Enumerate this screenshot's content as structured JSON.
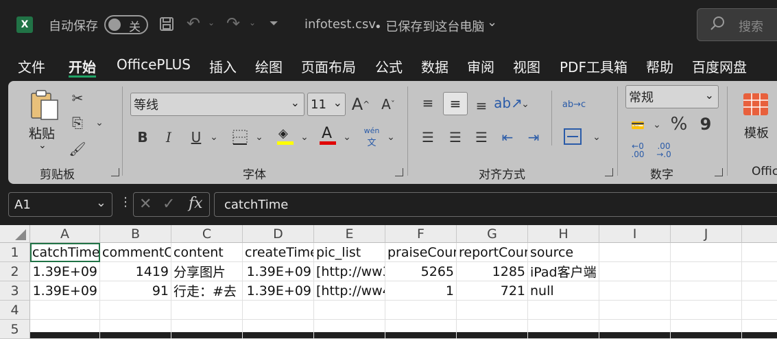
{
  "titlebar": {
    "autosave_label": "自动保存",
    "autosave_state": "关",
    "filename": "infotest.csv",
    "save_status": "• 已保存到这台电脑",
    "search_placeholder": "搜索"
  },
  "tabs": [
    "文件",
    "开始",
    "OfficePLUS",
    "插入",
    "绘图",
    "页面布局",
    "公式",
    "数据",
    "审阅",
    "视图",
    "PDF工具箱",
    "帮助",
    "百度网盘"
  ],
  "ribbon": {
    "clipboard": {
      "paste_label": "粘贴",
      "group_label": "剪贴板"
    },
    "font": {
      "font_name": "等线",
      "font_size": "11",
      "group_label": "字体",
      "bold": "B",
      "italic": "I",
      "underline": "U",
      "grow": "A",
      "shrink": "A",
      "font_color": "A",
      "phonetic_top": "wén",
      "phonetic_bottom": "文"
    },
    "alignment": {
      "group_label": "对齐方式",
      "wrap_text": "ab→c"
    },
    "number": {
      "format": "常规",
      "group_label": "数字",
      "percent": "%",
      "comma": "9",
      "inc_dec": "←0 .00",
      "dec_dec": ".00 →.0"
    },
    "styles": {
      "template_label": "模板",
      "group_label": "Offic"
    }
  },
  "formula_bar": {
    "name_box": "A1",
    "fx": "fx",
    "content": "catchTime"
  },
  "grid": {
    "columns": [
      "A",
      "B",
      "C",
      "D",
      "E",
      "F",
      "G",
      "H",
      "I",
      "J",
      ""
    ],
    "rows": [
      "1",
      "2",
      "3",
      "4",
      "5"
    ],
    "cells": [
      [
        "catchTime",
        "commentC",
        "content",
        "createTime",
        "pic_list",
        "praiseCour",
        "reportCour",
        "source",
        "",
        "",
        ""
      ],
      [
        "1.39E+09",
        "1419",
        "分享图片",
        "1.39E+09",
        "[http://ww3",
        "5265",
        "1285",
        "iPad客户端",
        "",
        "",
        ""
      ],
      [
        "1.39E+09",
        "91",
        "行走：#去",
        "1.39E+09",
        "[http://ww4",
        "1",
        "721",
        "null",
        "",
        "",
        ""
      ],
      [
        "",
        "",
        "",
        "",
        "",
        "",
        "",
        "",
        "",
        "",
        ""
      ],
      [
        "",
        "",
        "",
        "",
        "",
        "",
        "",
        "",
        "",
        "",
        ""
      ]
    ]
  },
  "colors": {
    "accent_green": "#217346",
    "title_bg": "#1f1f1f",
    "ribbon_bg": "#c4c4c4",
    "highlight_yellow": "#ffff00",
    "font_red": "#e00000"
  }
}
